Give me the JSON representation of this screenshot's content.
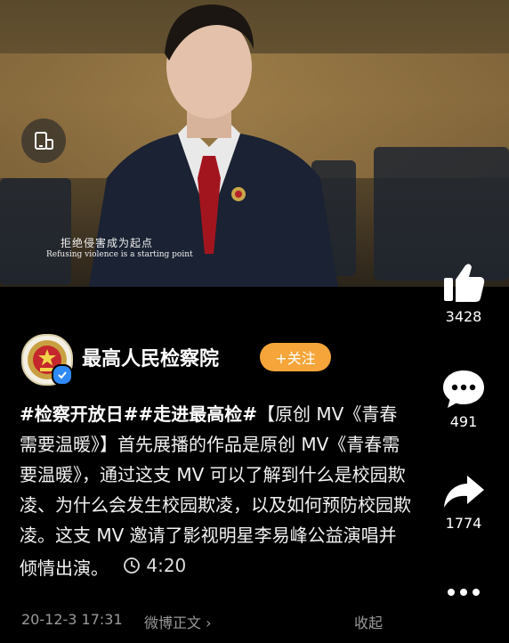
{
  "video": {
    "subtitle_cn": "拒绝侵害成为起点",
    "subtitle_en": "Refusing violence is a starting point"
  },
  "actions": {
    "like_count": "3428",
    "comment_count": "491",
    "share_count": "1774"
  },
  "account": {
    "name": "最高人民检察院",
    "follow_label": "+关注"
  },
  "post": {
    "hashtags": "#检察开放日##走进最高检#",
    "text": "【原创 MV《青春需要温暖》】首先展播的作品是原创 MV《青春需要温暖》，通过这支 MV 可以了解到什么是校园欺凌、为什么会发生校园欺凌，以及如何预防校园欺凌。这支 MV 邀请了影视明星李易峰公益演唱并倾情出演。",
    "duration": "4:20"
  },
  "footer": {
    "timestamp": "20-12-3 17:31",
    "weibo_body_label": "微博正文",
    "chevron": "›",
    "collapse_label": "收起"
  },
  "colors": {
    "background": "#000000",
    "follow_button": "#f5a53a",
    "verified_badge": "#2f8af5",
    "muted_text": "#9a9a9a"
  },
  "icons": [
    "screen-rotate-icon",
    "thumbs-up-icon",
    "comment-icon",
    "share-icon",
    "more-icon",
    "clock-icon",
    "verified-icon"
  ]
}
